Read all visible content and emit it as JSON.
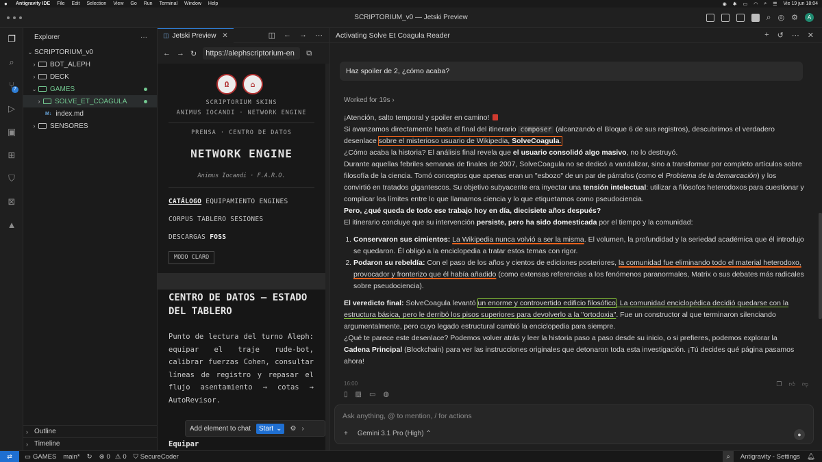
{
  "menubar": {
    "app_name": "Antigravity IDE",
    "items": [
      "File",
      "Edit",
      "Selection",
      "View",
      "Go",
      "Run",
      "Terminal",
      "Window",
      "Help"
    ],
    "datetime": "Vie 19 jun  18:04"
  },
  "window": {
    "title": "SCRIPTORIUM_v0 — Jetski Preview",
    "avatar_initial": "A"
  },
  "explorer": {
    "title": "Explorer",
    "more": "···",
    "root": "SCRIPTORIUM_v0",
    "items": [
      {
        "label": "BOT_ALEPH"
      },
      {
        "label": "DECK"
      },
      {
        "label": "GAMES"
      },
      {
        "label": "SOLVE_ET_COAGULA"
      },
      {
        "label": "index.md",
        "icon_text": "M↓"
      },
      {
        "label": "SENSORES"
      }
    ],
    "outline": "Outline",
    "timeline": "Timeline"
  },
  "preview": {
    "tab_label": "Jetski Preview",
    "url": "https://alephscriptorium-en",
    "site": {
      "kicker1": "SCRIPTORIUM SKINS",
      "kicker2": "ANIMUS IOCANDI · NETWORK ENGINE",
      "section": "PRENSA · CENTRO DE DATOS",
      "title": "NETWORK ENGINE",
      "subtitle": "Animus Iocandi · F.A.R.O.",
      "nav1_active": "CATÁLOGO",
      "nav1_rest": "EQUIPAMIENTO ENGINES",
      "nav2": "CORPUS TABLERO SESIONES",
      "nav3_a": "DESCARGAS",
      "nav3_b": "FOSS",
      "mode_button": "MODO CLARO",
      "heading": "CENTRO DE DATOS — ESTADO DEL TABLERO",
      "paragraph": "Punto de lectura del turno Aleph: equipar el traje rude-bot, calibrar fuerzas Cohen, consultar líneas de registro y repasar el flujo asentamiento → cotas → AutoRevisor.",
      "next_heading": "Equipar"
    },
    "add_element": "Add element to chat",
    "start": "Start"
  },
  "agent": {
    "title": "Activating Solve Et Coagula Reader",
    "user_message": "Haz spoiler de 2, ¿cómo acaba?",
    "worked_for": "Worked for 19s",
    "timestamp": "16:00",
    "composer_placeholder": "Ask anything, @ to mention, / for actions",
    "model": "Gemini 3.1 Pro (High)",
    "response": {
      "intro": "¡Atención, salto temporal y spoiler en camino!",
      "p1_a": "Si avanzamos directamente hasta el final del itinerario",
      "p1_code": "composer",
      "p1_b": "(alcanzando el Bloque 6 de sus registros), descubrimos el verdadero desenlace",
      "p1_box_a": "sobre el misterioso usuario de Wikipedia,",
      "p1_box_b": "SolveCoagula",
      "p2_a": "¿Cómo acaba la historia? El análisis final revela que",
      "p2_b": "el usuario consolidó algo masivo",
      "p2_c": ", no lo destruyó.",
      "p3_a": "Durante aquellas febriles semanas de finales de 2007, SolveCoagula no se dedicó a vandalizar, sino a transformar por completo artículos sobre filosofía de la ciencia. Tomó conceptos que apenas eran un \"esbozo\" de un par de párrafos (como el",
      "p3_em": "Problema de la demarcación",
      "p3_b": ") y los convirtió en tratados gigantescos. Su objetivo subyacente era inyectar una",
      "p3_strong": "tensión intelectual",
      "p3_c": ": utilizar a filósofos heterodoxos para cuestionar y complicar los límites entre lo que llamamos ciencia y lo que etiquetamos como pseudociencia.",
      "q": "Pero, ¿qué queda de todo ese trabajo hoy en día, diecisiete años después?",
      "p4_a": "El itinerario concluye que su intervención",
      "p4_b": "persiste, pero ha sido domesticada",
      "p4_c": "por el tiempo y la comunidad:",
      "li1_strong": "Conservaron sus cimientos:",
      "li1_ul": "La Wikipedia nunca volvió a ser la misma",
      "li1_rest": ". El volumen, la profundidad y la seriedad académica que él introdujo se quedaron. Él obligó a la enciclopedia a tratar estos temas con rigor.",
      "li2_strong": "Podaron su rebeldía:",
      "li2_a": "Con el paso de los años y cientos de ediciones posteriores,",
      "li2_ul": "la comunidad fue eliminando todo el material heterodoxo, provocador y fronterizo que él había añadido",
      "li2_rest": "(como extensas referencias a los fenómenos paranormales, Matrix o sus debates más radicales sobre pseudociencia).",
      "v_strong": "El veredicto final:",
      "v_a": "SolveCoagula levantó",
      "v_box": "un enorme y controvertido edificio filosófico",
      "v_ul": ". La comunidad enciclopédica decidió quedarse con la estructura básica, pero le derribó los pisos superiores para devolverlo a la \"ortodoxia\"",
      "v_rest": ". Fue un constructor al que terminaron silenciando argumentalmente, pero cuyo legado estructural cambió la enciclopedia para siempre.",
      "close_a": "¿Qué te parece este desenlace? Podemos volver atrás y leer la historia paso a paso desde su inicio, o si prefieres, podemos explorar la",
      "close_strong": "Cadena Principal",
      "close_b": "(Blockchain) para ver las instrucciones originales que detonaron toda esta investigación. ¡Tú decides qué página pasamos ahora!"
    }
  },
  "statusbar": {
    "branch_folder": "GAMES",
    "branch": "main*",
    "errors": "0",
    "warnings": "0",
    "extension": "SecureCoder",
    "right_label": "Antigravity - Settings"
  },
  "colors": {
    "accent": "#1f6fd1",
    "highlight_red": "#e8611a",
    "highlight_green": "#86c23a",
    "git_green": "#73c991"
  }
}
